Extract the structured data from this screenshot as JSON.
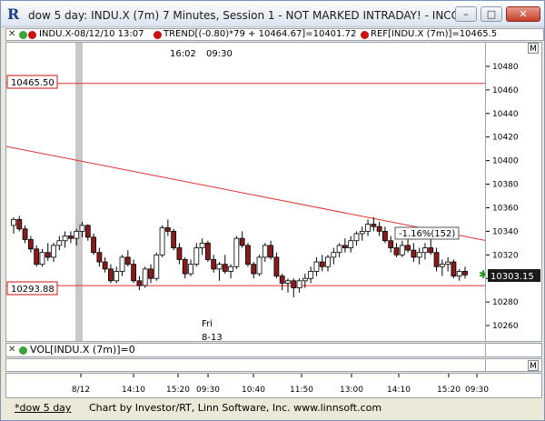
{
  "window": {
    "title": "dow 5 day: INDU.X (7m) 7 Minutes, Session 1 - NOT MARKED INTRADAY! - INCO...",
    "minimize_label": "–",
    "maximize_label": "□",
    "close_label": "✕"
  },
  "legend": {
    "close_x": "✕",
    "items": [
      {
        "label": "INDU.X-08/12/10 13:07",
        "color": "#3aa23a"
      },
      {
        "label": "TREND[(-0.80)*79 + 10464.67]=10401.72",
        "color": "#cc1111"
      },
      {
        "label": "REF[INDU.X (7m)]=10465.5",
        "color": "#cc1111"
      }
    ]
  },
  "chart_annotations": {
    "session_time": "16:02",
    "session_start": "09:30",
    "day_label": "Fri",
    "date_label": "8-13",
    "ref_label": "10465.50",
    "support_label": "10293.88",
    "pct_label": "-1.16%(152)",
    "current_price": "10303.15",
    "m_button": "M"
  },
  "volume": {
    "label": "VOL[INDU.X (7m)]=0",
    "color": "#3aa23a"
  },
  "status": {
    "tab": "*dow 5 day",
    "credit": "Chart by Investor/RT, Linn Software, Inc. www.linnsoft.com"
  },
  "chart_data": {
    "type": "candlestick",
    "ylim": [
      10250,
      10490
    ],
    "y_ticks": [
      "10480",
      "10460",
      "10440",
      "10420",
      "10400",
      "10380",
      "10360",
      "10340",
      "10320",
      "10300",
      "10280",
      "10260"
    ],
    "x_ticks": [
      "8/12",
      "14:10",
      "15:20",
      "09:30",
      "10:40",
      "11:50",
      "13:00",
      "14:10",
      "15:20",
      "09:30"
    ],
    "ref_line": 10465.5,
    "support_line": 10293.88,
    "trend_line": {
      "start": 10412,
      "end": 10332
    },
    "last_price": 10303.15,
    "colors": {
      "up": "#ffffff",
      "down": "#8b1a1a",
      "wick": "#000000",
      "lines": "#e03030"
    },
    "candles": [
      [
        10345,
        10352,
        10338,
        10350
      ],
      [
        10350,
        10353,
        10340,
        10342
      ],
      [
        10342,
        10345,
        10330,
        10333
      ],
      [
        10333,
        10336,
        10322,
        10325
      ],
      [
        10325,
        10328,
        10310,
        10312
      ],
      [
        10312,
        10325,
        10310,
        10322
      ],
      [
        10322,
        10330,
        10315,
        10318
      ],
      [
        10318,
        10330,
        10314,
        10328
      ],
      [
        10328,
        10336,
        10324,
        10332
      ],
      [
        10332,
        10340,
        10326,
        10336
      ],
      [
        10336,
        10340,
        10330,
        10334
      ],
      [
        10334,
        10342,
        10328,
        10340
      ],
      [
        10340,
        10348,
        10335,
        10345
      ],
      [
        10345,
        10346,
        10332,
        10335
      ],
      [
        10335,
        10338,
        10320,
        10322
      ],
      [
        10322,
        10326,
        10310,
        10314
      ],
      [
        10314,
        10318,
        10305,
        10308
      ],
      [
        10308,
        10312,
        10296,
        10298
      ],
      [
        10298,
        10310,
        10296,
        10306
      ],
      [
        10306,
        10320,
        10302,
        10318
      ],
      [
        10318,
        10324,
        10310,
        10312
      ],
      [
        10312,
        10316,
        10296,
        10298
      ],
      [
        10298,
        10302,
        10290,
        10294
      ],
      [
        10294,
        10310,
        10292,
        10308
      ],
      [
        10308,
        10312,
        10296,
        10300
      ],
      [
        10300,
        10322,
        10298,
        10320
      ],
      [
        10320,
        10345,
        10318,
        10343
      ],
      [
        10343,
        10350,
        10336,
        10340
      ],
      [
        10340,
        10342,
        10324,
        10326
      ],
      [
        10326,
        10330,
        10312,
        10316
      ],
      [
        10316,
        10318,
        10300,
        10304
      ],
      [
        10304,
        10316,
        10302,
        10312
      ],
      [
        10312,
        10330,
        10310,
        10326
      ],
      [
        10326,
        10334,
        10320,
        10330
      ],
      [
        10330,
        10332,
        10314,
        10316
      ],
      [
        10316,
        10320,
        10305,
        10308
      ],
      [
        10308,
        10314,
        10298,
        10312
      ],
      [
        10312,
        10320,
        10304,
        10306
      ],
      [
        10306,
        10312,
        10300,
        10310
      ],
      [
        10310,
        10336,
        10308,
        10334
      ],
      [
        10334,
        10340,
        10326,
        10328
      ],
      [
        10328,
        10330,
        10310,
        10312
      ],
      [
        10312,
        10314,
        10300,
        10304
      ],
      [
        10304,
        10320,
        10302,
        10318
      ],
      [
        10318,
        10330,
        10314,
        10328
      ],
      [
        10328,
        10332,
        10316,
        10318
      ],
      [
        10318,
        10322,
        10300,
        10302
      ],
      [
        10302,
        10304,
        10290,
        10296
      ],
      [
        10296,
        10300,
        10288,
        10298
      ],
      [
        10298,
        10300,
        10284,
        10292
      ],
      [
        10292,
        10300,
        10288,
        10298
      ],
      [
        10298,
        10304,
        10292,
        10300
      ],
      [
        10300,
        10310,
        10296,
        10306
      ],
      [
        10306,
        10318,
        10302,
        10314
      ],
      [
        10314,
        10320,
        10306,
        10310
      ],
      [
        10310,
        10320,
        10306,
        10318
      ],
      [
        10318,
        10326,
        10312,
        10322
      ],
      [
        10322,
        10330,
        10318,
        10328
      ],
      [
        10328,
        10334,
        10322,
        10326
      ],
      [
        10326,
        10336,
        10322,
        10332
      ],
      [
        10332,
        10340,
        10328,
        10338
      ],
      [
        10338,
        10344,
        10332,
        10340
      ],
      [
        10340,
        10350,
        10336,
        10346
      ],
      [
        10346,
        10352,
        10340,
        10344
      ],
      [
        10344,
        10348,
        10336,
        10340
      ],
      [
        10340,
        10344,
        10330,
        10332
      ],
      [
        10332,
        10336,
        10322,
        10326
      ],
      [
        10326,
        10330,
        10318,
        10320
      ],
      [
        10320,
        10332,
        10318,
        10328
      ],
      [
        10328,
        10336,
        10322,
        10324
      ],
      [
        10324,
        10330,
        10314,
        10318
      ],
      [
        10318,
        10326,
        10312,
        10322
      ],
      [
        10322,
        10330,
        10316,
        10326
      ],
      [
        10326,
        10334,
        10320,
        10322
      ],
      [
        10322,
        10326,
        10306,
        10310
      ],
      [
        10310,
        10316,
        10302,
        10312
      ],
      [
        10312,
        10318,
        10306,
        10314
      ],
      [
        10314,
        10316,
        10300,
        10302
      ],
      [
        10302,
        10308,
        10298,
        10306
      ],
      [
        10306,
        10310,
        10300,
        10303
      ]
    ]
  }
}
